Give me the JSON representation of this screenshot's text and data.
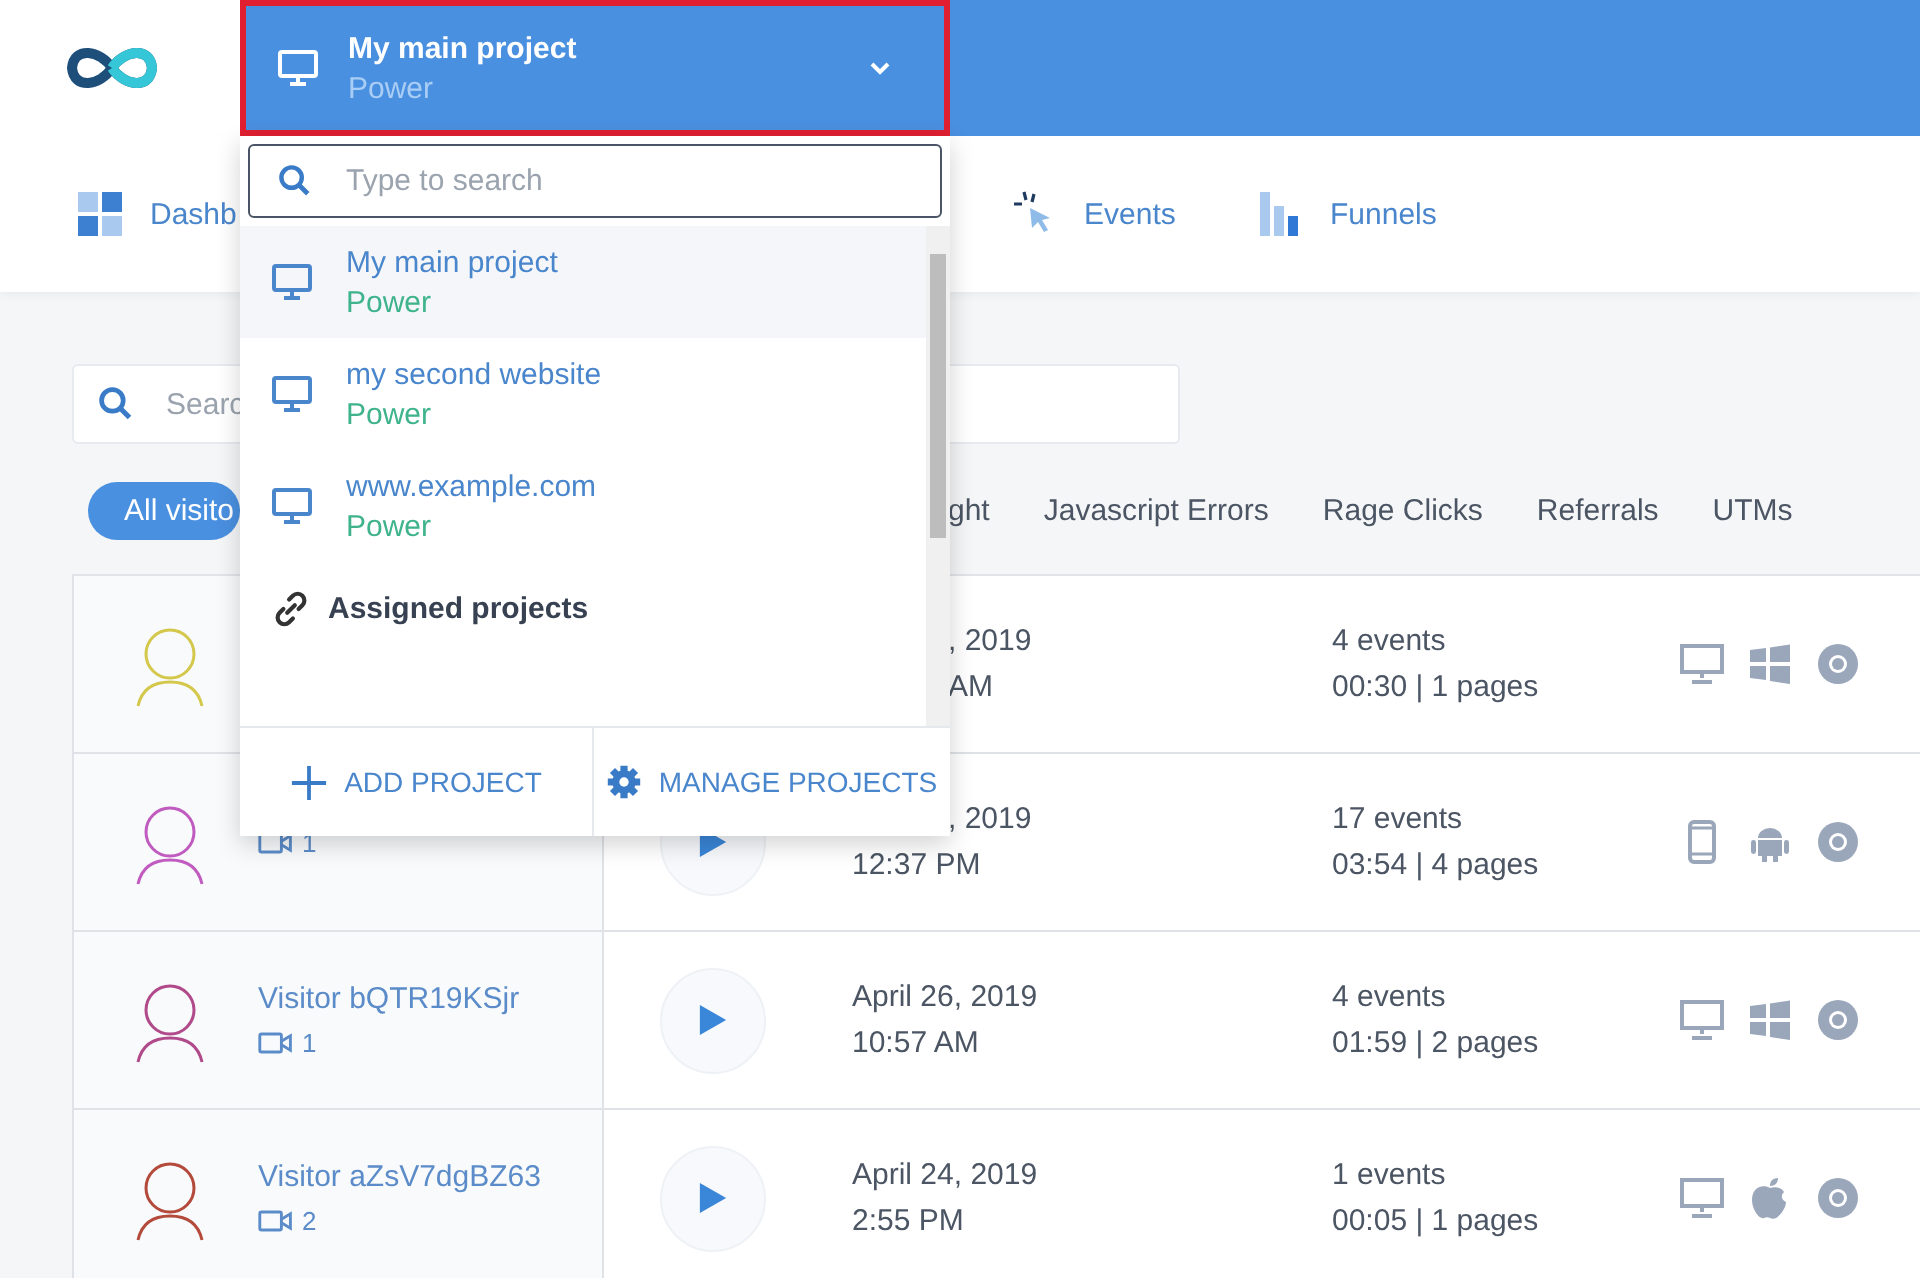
{
  "project_selector": {
    "name": "My main project",
    "plan": "Power",
    "expanded": true
  },
  "dropdown": {
    "search": {
      "placeholder": "Type to search"
    },
    "projects": [
      {
        "name": "My main project",
        "plan": "Power",
        "selected": true
      },
      {
        "name": "my second website",
        "plan": "Power",
        "selected": false
      },
      {
        "name": "www.example.com",
        "plan": "Power",
        "selected": false
      }
    ],
    "section_heading": "Assigned projects",
    "actions": [
      {
        "kind": "add",
        "label": "ADD PROJECT"
      },
      {
        "kind": "manage",
        "label": "MANAGE PROJECTS"
      }
    ]
  },
  "nav": [
    {
      "kind": "dashboard",
      "label": "Dashb"
    },
    {
      "kind": "events",
      "label": "Events"
    },
    {
      "kind": "funnels",
      "label": "Funnels"
    }
  ],
  "search": {
    "placeholder": "Searc"
  },
  "filters": [
    {
      "label": "All visito",
      "selected": true
    },
    {
      "label": "ght",
      "selected": false
    },
    {
      "label": "Javascript Errors",
      "selected": false
    },
    {
      "label": "Rage Clicks",
      "selected": false
    },
    {
      "label": "Referrals",
      "selected": false
    },
    {
      "label": "UTMs",
      "selected": false
    }
  ],
  "visitors": [
    {
      "color": "#d4c84c",
      "date": ", 2019",
      "time": "AM",
      "events": "4 events",
      "duration": "00:30 | 1 pages",
      "devices": [
        {
          "kind": "desktop"
        },
        {
          "kind": "windows"
        },
        {
          "kind": "chrome"
        }
      ]
    },
    {
      "color": "#c05cc0",
      "recordings": "1",
      "date": ", 2019",
      "time": "12:37 PM",
      "events": "17 events",
      "duration": "03:54 | 4 pages",
      "devices": [
        {
          "kind": "mobile"
        },
        {
          "kind": "android"
        },
        {
          "kind": "chrome"
        }
      ]
    },
    {
      "color": "#b04a8a",
      "name": "Visitor bQTR19KSjr",
      "recordings": "1",
      "date": "April 26, 2019",
      "time": "10:57 AM",
      "events": "4 events",
      "duration": "01:59 | 2 pages",
      "devices": [
        {
          "kind": "desktop"
        },
        {
          "kind": "windows"
        },
        {
          "kind": "chrome"
        }
      ]
    },
    {
      "color": "#b44a3c",
      "name": "Visitor aZsV7dgBZ63",
      "recordings": "2",
      "date": "April 24, 2019",
      "time": "2:55 PM",
      "events": "1 events",
      "duration": "00:05 | 1 pages",
      "devices": [
        {
          "kind": "desktop"
        },
        {
          "kind": "apple"
        },
        {
          "kind": "chrome"
        }
      ]
    }
  ]
}
